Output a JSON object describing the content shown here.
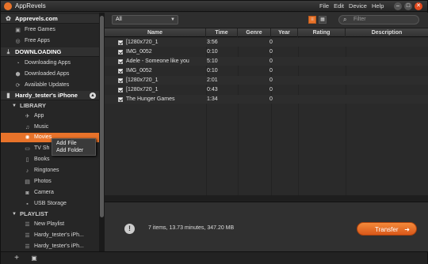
{
  "app": {
    "title": "AppRevels"
  },
  "menu": [
    "File",
    "Edit",
    "Device",
    "Help"
  ],
  "window_buttons": {
    "minimize": "–",
    "maximize": "□",
    "close": "✕"
  },
  "sidebar": {
    "apprevels_section": "Apprevels.com",
    "free_games": "Free Games",
    "free_apps": "Free Apps",
    "downloading_section": "DOWNLOADING",
    "downloading_apps": "Downloading Apps",
    "downloaded_apps": "Downloaded Apps",
    "available_updates": "Available Updates",
    "device_name": "Hardy_tester's iPhone",
    "library_label": "LIBRARY",
    "library_items": [
      "App",
      "Music",
      "Movies",
      "TV Shows",
      "Books",
      "Ringtones",
      "Photos",
      "Camera",
      "USB Storage"
    ],
    "tv_shows_visible": "TV Sh",
    "playlist_label": "PLAYLIST",
    "playlist_items": [
      "New Playlist",
      "Hardy_tester's iPh...",
      "Hardy_tester's iPh..."
    ]
  },
  "context_menu": {
    "add_file": "Add File",
    "add_folder": "Add Folder"
  },
  "toolbar": {
    "filter_value": "All",
    "search_placeholder": "Filter"
  },
  "table": {
    "columns": [
      "Name",
      "Time",
      "Genre",
      "Year",
      "Rating",
      "Description"
    ],
    "rows": [
      {
        "name": "[1280x720_1",
        "time": "3:56",
        "year": "0"
      },
      {
        "name": "IMG_0052",
        "time": "0:10",
        "year": "0"
      },
      {
        "name": "Adele - Someone like you",
        "time": "5:10",
        "year": "0"
      },
      {
        "name": "IMG_0052",
        "time": "0:10",
        "year": "0"
      },
      {
        "name": "[1280x720_1",
        "time": "2:01",
        "year": "0"
      },
      {
        "name": "[1280x720_1",
        "time": "0:43",
        "year": "0"
      },
      {
        "name": "The Hunger Games",
        "time": "1:34",
        "year": "0"
      }
    ]
  },
  "status": {
    "summary": "7 items, 13.73 minutes, 347.20 MB",
    "transfer_label": "Transfer"
  },
  "colors": {
    "accent": "#e8732a",
    "background": "#2a2a2a"
  }
}
